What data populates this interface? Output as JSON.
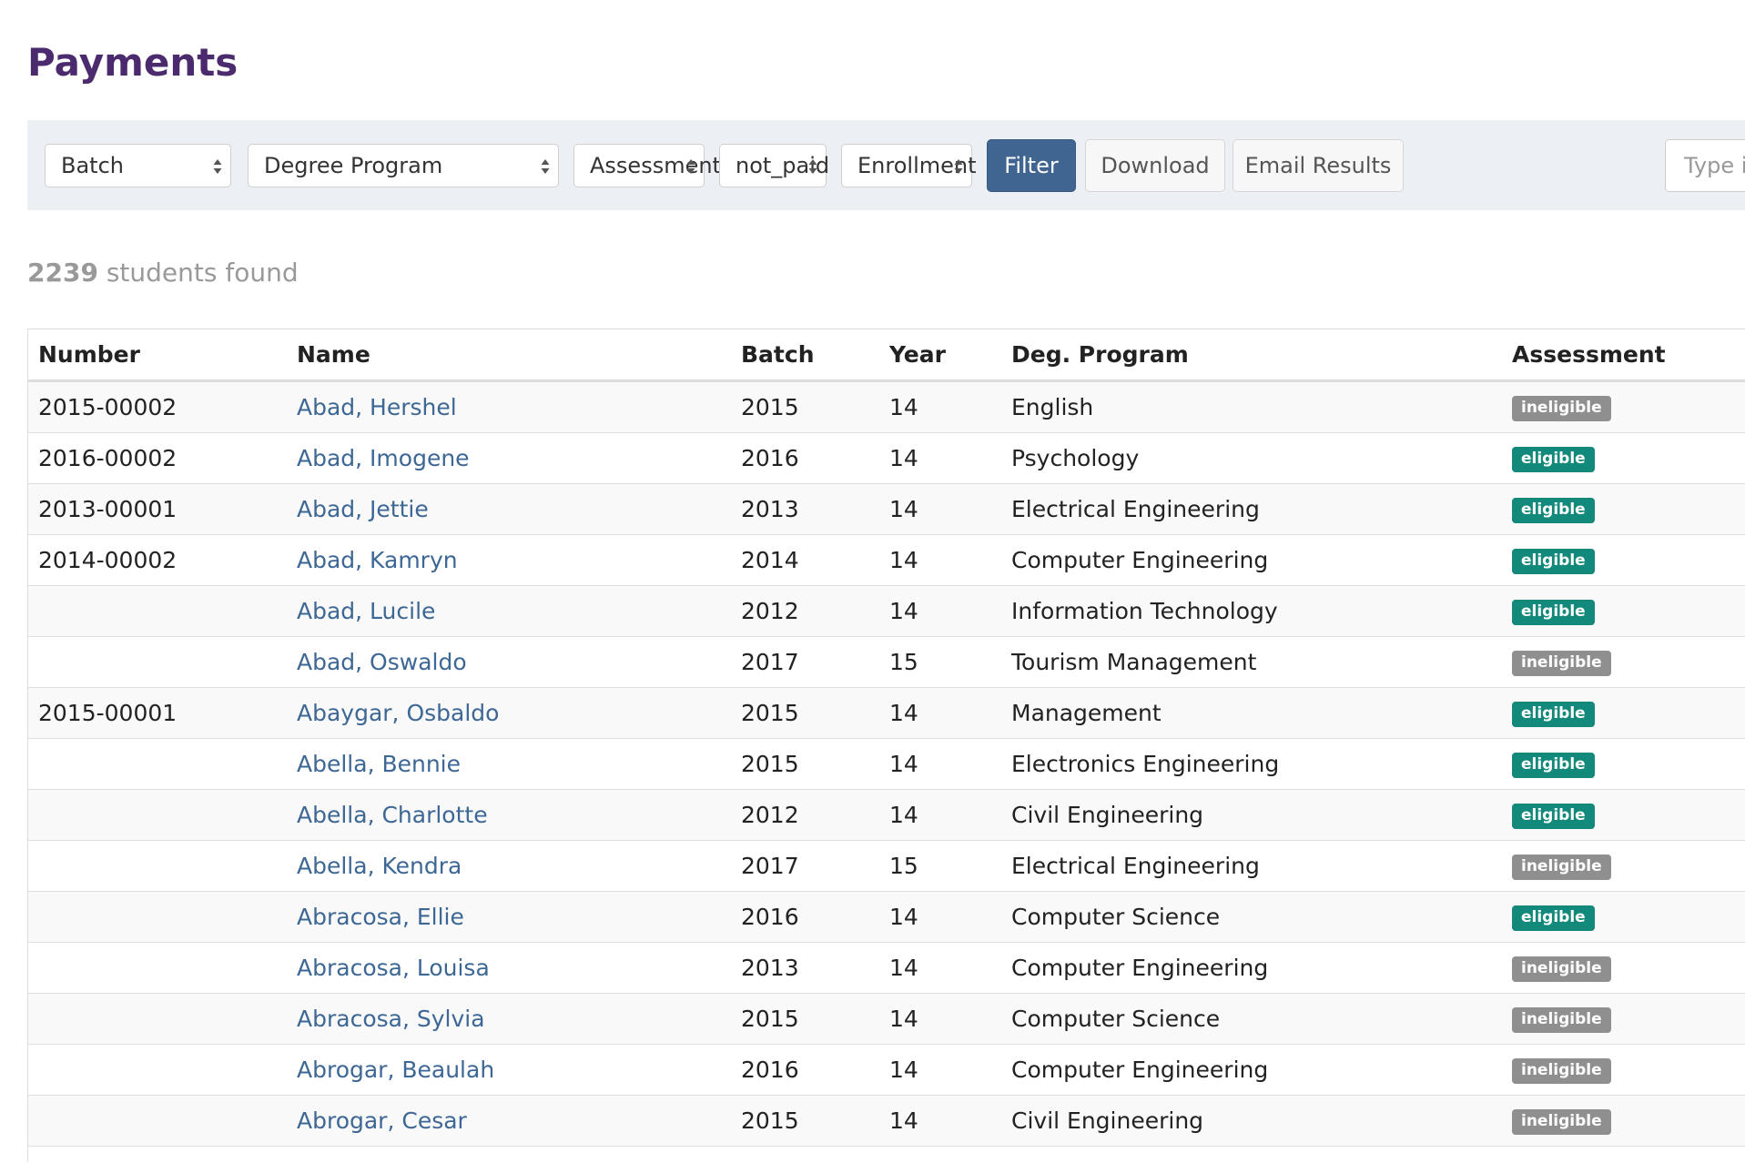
{
  "page": {
    "title": "Payments"
  },
  "filters": {
    "batch": {
      "selected": "Batch"
    },
    "degree_program": {
      "selected": "Degree Program"
    },
    "assessment": {
      "selected": "Assessment"
    },
    "payment_status": {
      "selected": "not_paid"
    },
    "enrollment": {
      "selected": "Enrollment"
    },
    "filter_label": "Filter",
    "download_label": "Download",
    "email_results_label": "Email Results",
    "search_placeholder": "Type in student name"
  },
  "results": {
    "count": "2239",
    "suffix": " students found"
  },
  "table": {
    "headers": [
      "Number",
      "Name",
      "Batch",
      "Year",
      "Deg. Program",
      "Assessment"
    ],
    "rows": [
      {
        "number": "2015-00002",
        "name": "Abad, Hershel",
        "batch": "2015",
        "year": "14",
        "program": "English",
        "assessment": "ineligible"
      },
      {
        "number": "2016-00002",
        "name": "Abad, Imogene",
        "batch": "2016",
        "year": "14",
        "program": "Psychology",
        "assessment": "eligible"
      },
      {
        "number": "2013-00001",
        "name": "Abad, Jettie",
        "batch": "2013",
        "year": "14",
        "program": "Electrical Engineering",
        "assessment": "eligible"
      },
      {
        "number": "2014-00002",
        "name": "Abad, Kamryn",
        "batch": "2014",
        "year": "14",
        "program": "Computer Engineering",
        "assessment": "eligible"
      },
      {
        "number": "",
        "name": "Abad, Lucile",
        "batch": "2012",
        "year": "14",
        "program": "Information Technology",
        "assessment": "eligible"
      },
      {
        "number": "",
        "name": "Abad, Oswaldo",
        "batch": "2017",
        "year": "15",
        "program": "Tourism Management",
        "assessment": "ineligible"
      },
      {
        "number": "2015-00001",
        "name": "Abaygar, Osbaldo",
        "batch": "2015",
        "year": "14",
        "program": "Management",
        "assessment": "eligible"
      },
      {
        "number": "",
        "name": "Abella, Bennie",
        "batch": "2015",
        "year": "14",
        "program": "Electronics Engineering",
        "assessment": "eligible"
      },
      {
        "number": "",
        "name": "Abella, Charlotte",
        "batch": "2012",
        "year": "14",
        "program": "Civil Engineering",
        "assessment": "eligible"
      },
      {
        "number": "",
        "name": "Abella, Kendra",
        "batch": "2017",
        "year": "15",
        "program": "Electrical Engineering",
        "assessment": "ineligible"
      },
      {
        "number": "",
        "name": "Abracosa, Ellie",
        "batch": "2016",
        "year": "14",
        "program": "Computer Science",
        "assessment": "eligible"
      },
      {
        "number": "",
        "name": "Abracosa, Louisa",
        "batch": "2013",
        "year": "14",
        "program": "Computer Engineering",
        "assessment": "ineligible"
      },
      {
        "number": "",
        "name": "Abracosa, Sylvia",
        "batch": "2015",
        "year": "14",
        "program": "Computer Science",
        "assessment": "ineligible"
      },
      {
        "number": "",
        "name": "Abrogar, Beaulah",
        "batch": "2016",
        "year": "14",
        "program": "Computer Engineering",
        "assessment": "ineligible"
      },
      {
        "number": "",
        "name": "Abrogar, Cesar",
        "batch": "2015",
        "year": "14",
        "program": "Civil Engineering",
        "assessment": "ineligible"
      }
    ]
  },
  "colors": {
    "title": "#4b2a6e",
    "primary_button": "#3f6590",
    "link": "#3d6794",
    "eligible_badge": "#12897a",
    "ineligible_badge": "#8f8f8f"
  },
  "icons": {
    "select_arrows": "up-down-arrows-icon"
  }
}
